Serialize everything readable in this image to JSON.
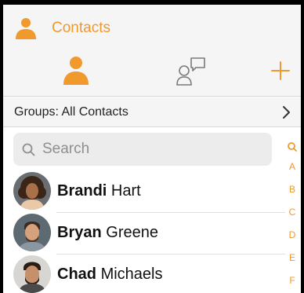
{
  "header": {
    "title": "Contacts"
  },
  "groups": {
    "label": "Groups: All Contacts"
  },
  "search": {
    "placeholder": "Search"
  },
  "contacts": [
    {
      "first": "Brandi",
      "last": "Hart"
    },
    {
      "first": "Bryan",
      "last": "Greene"
    },
    {
      "first": "Chad",
      "last": "Michaels"
    }
  ],
  "index_letters": [
    "A",
    "B",
    "C",
    "D",
    "E",
    "F"
  ],
  "colors": {
    "accent": "#f0992c",
    "header_bg": "#f5f5f5"
  },
  "icons": {
    "app": "person-icon",
    "tab_contacts": "person-icon",
    "tab_chat": "person-chat-icon",
    "tab_add": "plus-icon",
    "groups": "chevron-right-icon",
    "search": "search-icon",
    "index_search": "search-icon"
  }
}
